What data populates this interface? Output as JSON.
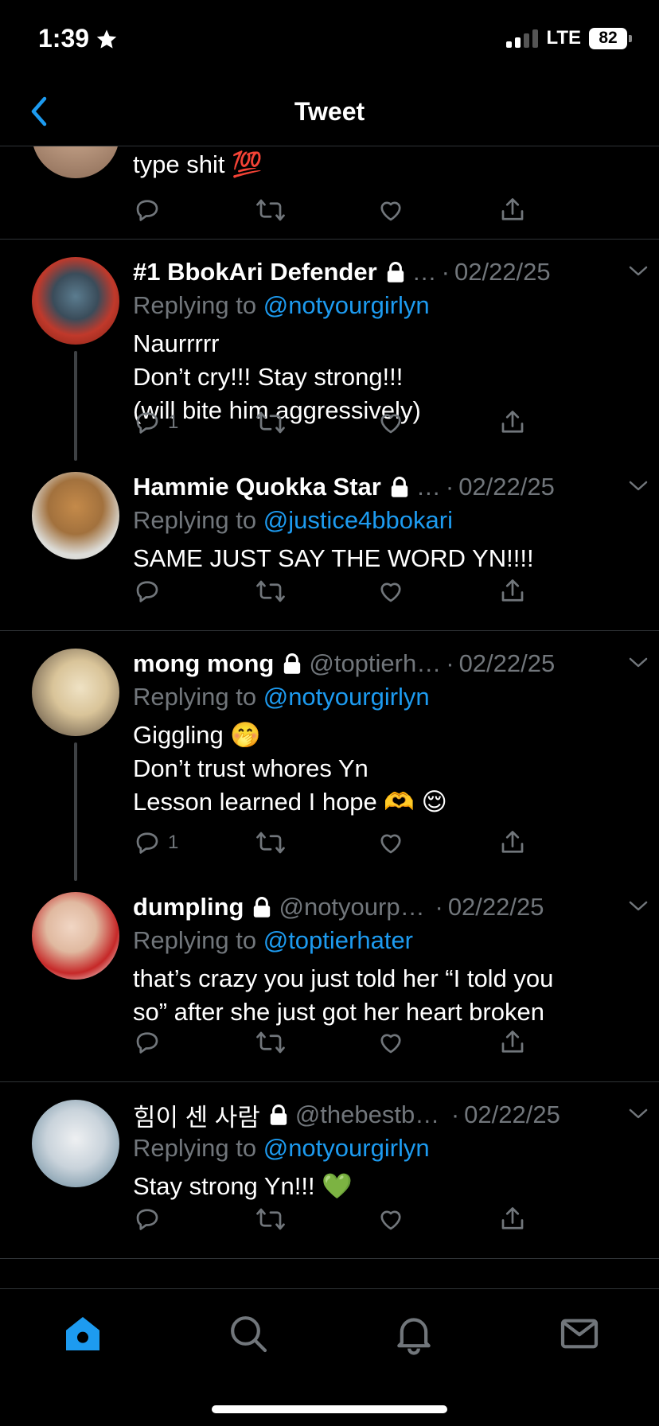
{
  "status_bar": {
    "time": "1:39",
    "network": "LTE",
    "battery": "82"
  },
  "header": {
    "title": "Tweet"
  },
  "tweets": [
    {
      "text_lines": [
        "type shit 💯"
      ],
      "reply_count": ""
    },
    {
      "name": "#1 BbokAri Defender",
      "handle": "…",
      "date": "02/22/25",
      "replying_prefix": "Replying to",
      "replying_to": "@notyourgirlyn",
      "text_lines": [
        "Naurrrrr",
        "Don’t cry!!! Stay strong!!!",
        "(will bite him aggressively)"
      ],
      "reply_count": "1"
    },
    {
      "name": "Hammie Quokka Star",
      "handle": "…",
      "date": "02/22/25",
      "replying_prefix": "Replying to",
      "replying_to": "@justice4bbokari",
      "text_lines": [
        "SAME JUST SAY THE WORD YN!!!!"
      ],
      "reply_count": ""
    },
    {
      "name": "mong mong",
      "handle": "@toptierh…",
      "date": "02/22/25",
      "replying_prefix": "Replying to",
      "replying_to": "@notyourgirlyn",
      "text_lines": [
        "Giggling 🤭",
        "Don’t trust whores Yn",
        "Lesson learned I hope 🫶 😌"
      ],
      "reply_count": "1"
    },
    {
      "name": "dumpling",
      "handle": "@notyourpri…",
      "date": "02/22/25",
      "replying_prefix": "Replying to",
      "replying_to": "@toptierhater",
      "text_lines": [
        "that’s crazy you just told her “I told you",
        "so” after she just got her heart broken"
      ],
      "reply_count": ""
    },
    {
      "name": "힘이 센 사람",
      "handle": "@thebestbo…",
      "date": "02/22/25",
      "replying_prefix": "Replying to",
      "replying_to": "@notyourgirlyn",
      "text_lines": [
        "Stay strong Yn!!! 💚"
      ],
      "reply_count": ""
    }
  ],
  "colors": {
    "accent": "#1d9bf0",
    "muted": "#71767b",
    "background": "#000000",
    "divider": "#2f3336"
  },
  "tabs": [
    "home-icon",
    "search-icon",
    "bell-icon",
    "mail-icon"
  ]
}
